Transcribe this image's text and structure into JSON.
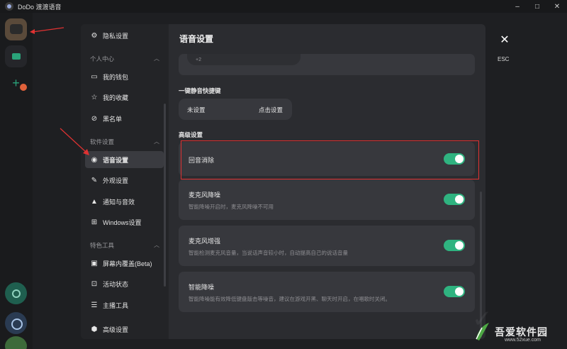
{
  "window": {
    "title": "DoDo 渡渡语音",
    "controls": [
      "–",
      "□",
      "✕"
    ]
  },
  "modal": {
    "title": "语音设置",
    "close_label": "ESC"
  },
  "sidebar": {
    "top_item": "隐私设置",
    "groups": [
      {
        "label": "个人中心",
        "items": [
          "我的钱包",
          "我的收藏",
          "黑名单"
        ]
      },
      {
        "label": "软件设置",
        "items": [
          "语音设置",
          "外观设置",
          "通知与音效",
          "Windows设置"
        ]
      },
      {
        "label": "特色工具",
        "items": [
          "屏幕内覆盖(Beta)",
          "活动状态",
          "主播工具"
        ]
      }
    ],
    "bottom_item": "高级设置"
  },
  "settings": {
    "partial_card_text": "+2",
    "hotkey": {
      "section_label": "一键静音快捷键",
      "value": "未设置",
      "action": "点击设置"
    },
    "advanced": {
      "section_label": "高级设置",
      "items": [
        {
          "label": "回音消除",
          "desc": "",
          "enabled": true
        },
        {
          "label": "麦克风降噪",
          "desc": "智能降噪开启时，麦克风降噪不可用",
          "enabled": true
        },
        {
          "label": "麦克风增强",
          "desc": "智能检测麦克风音量，当说话声音较小时，自动提高自己的说话音量",
          "enabled": true
        },
        {
          "label": "智能降噪",
          "desc": "智能降噪能有效降低键盘敲击等噪音，建议在游戏开黑、聊天时开启，在唱歌时关闭。",
          "enabled": true
        }
      ]
    }
  },
  "watermark": {
    "text": "吾爱软件园",
    "url": "www.52xue.com"
  },
  "colors": {
    "accent": "#2fb380",
    "highlight": "#e03232",
    "background": "#1e1f22",
    "panel": "#2b2c30"
  }
}
